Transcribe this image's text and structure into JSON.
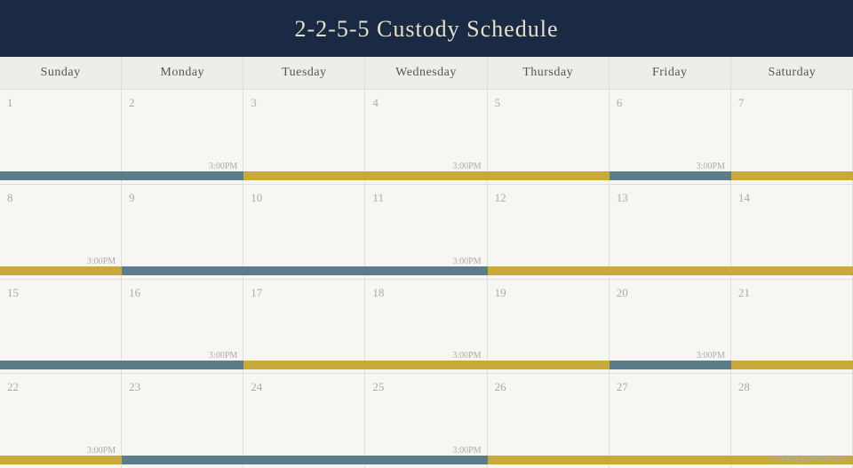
{
  "header": {
    "title": "2-2-5-5 Custody Schedule"
  },
  "days": {
    "headers": [
      "Sunday",
      "Monday",
      "Tuesday",
      "Wednesday",
      "Thursday",
      "Friday",
      "Saturday"
    ]
  },
  "weeks": [
    {
      "days": [
        {
          "number": "1",
          "time": null
        },
        {
          "number": "2",
          "time": "3:00PM"
        },
        {
          "number": "3",
          "time": null
        },
        {
          "number": "4",
          "time": "3:00PM"
        },
        {
          "number": "5",
          "time": null
        },
        {
          "number": "6",
          "time": "3:00PM"
        },
        {
          "number": "7",
          "time": null
        }
      ],
      "bars": [
        {
          "type": "blue",
          "start": 0,
          "cols": 2
        },
        {
          "type": "gold",
          "start": 2,
          "cols": 3
        },
        {
          "type": "blue",
          "start": 5,
          "cols": 1
        },
        {
          "type": "gold",
          "start": 6,
          "cols": 1
        }
      ]
    },
    {
      "days": [
        {
          "number": "8",
          "time": "3:00PM"
        },
        {
          "number": "9",
          "time": null
        },
        {
          "number": "10",
          "time": null
        },
        {
          "number": "11",
          "time": "3:00PM"
        },
        {
          "number": "12",
          "time": null
        },
        {
          "number": "13",
          "time": null
        },
        {
          "number": "14",
          "time": null
        }
      ],
      "bars": [
        {
          "type": "gold",
          "start": 0,
          "cols": 1
        },
        {
          "type": "blue",
          "start": 1,
          "cols": 3
        },
        {
          "type": "gold",
          "start": 4,
          "cols": 3
        }
      ]
    },
    {
      "days": [
        {
          "number": "15",
          "time": null
        },
        {
          "number": "16",
          "time": "3:00PM"
        },
        {
          "number": "17",
          "time": null
        },
        {
          "number": "18",
          "time": "3:00PM"
        },
        {
          "number": "19",
          "time": null
        },
        {
          "number": "20",
          "time": "3:00PM"
        },
        {
          "number": "21",
          "time": null
        }
      ],
      "bars": [
        {
          "type": "blue",
          "start": 0,
          "cols": 2
        },
        {
          "type": "gold",
          "start": 2,
          "cols": 3
        },
        {
          "type": "blue",
          "start": 5,
          "cols": 1
        },
        {
          "type": "gold",
          "start": 6,
          "cols": 1
        }
      ]
    },
    {
      "days": [
        {
          "number": "22",
          "time": "3:00PM"
        },
        {
          "number": "23",
          "time": null
        },
        {
          "number": "24",
          "time": null
        },
        {
          "number": "25",
          "time": "3:00PM"
        },
        {
          "number": "26",
          "time": null
        },
        {
          "number": "27",
          "time": null
        },
        {
          "number": "28",
          "time": null
        }
      ],
      "bars": [
        {
          "type": "gold",
          "start": 0,
          "cols": 1
        },
        {
          "type": "blue",
          "start": 1,
          "cols": 3
        },
        {
          "type": "gold",
          "start": 4,
          "cols": 3
        }
      ]
    }
  ],
  "watermark": "ourfamilywizard.com",
  "colors": {
    "blue_bar": "#5b7d8a",
    "gold_bar": "#c9a93c",
    "header_bg": "#1a2a44",
    "header_text": "#e8dfc8"
  }
}
